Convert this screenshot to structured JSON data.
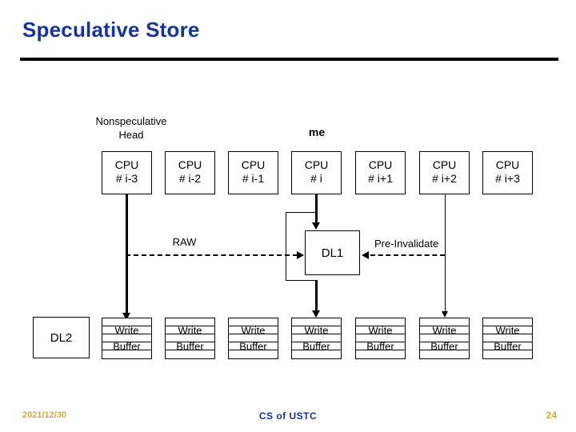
{
  "slide": {
    "title": "Speculative Store",
    "footer": {
      "date": "2021/12/30",
      "center": "CS of USTC",
      "page_number": "24"
    },
    "colors": {
      "title": "#17349a",
      "rule": "#000000",
      "footer_accent": "#d2aa3c",
      "footer_center": "#17349a",
      "diagram_line": "#000000",
      "background": "#ffffff"
    }
  },
  "diagram": {
    "labels": {
      "nonspeculative_head_line1": "Nonspeculative",
      "nonspeculative_head_line2": "Head",
      "me": "me",
      "raw": "RAW",
      "pre_invalidate": "Pre-Invalidate"
    },
    "cpus": [
      {
        "line1": "CPU",
        "line2": "# i-3"
      },
      {
        "line1": "CPU",
        "line2": "# i-2"
      },
      {
        "line1": "CPU",
        "line2": "# i-1"
      },
      {
        "line1": "CPU",
        "line2": "# i"
      },
      {
        "line1": "CPU",
        "line2": "# i+1"
      },
      {
        "line1": "CPU",
        "line2": "# i+2"
      },
      {
        "line1": "CPU",
        "line2": "# i+3"
      }
    ],
    "cache": {
      "dl1": "DL1",
      "dl2": "DL2"
    },
    "write_buffers": [
      {
        "line1": "Write",
        "line2": "Buffer"
      },
      {
        "line1": "Write",
        "line2": "Buffer"
      },
      {
        "line1": "Write",
        "line2": "Buffer"
      },
      {
        "line1": "Write",
        "line2": "Buffer"
      },
      {
        "line1": "Write",
        "line2": "Buffer"
      },
      {
        "line1": "Write",
        "line2": "Buffer"
      },
      {
        "line1": "Write",
        "line2": "Buffer"
      }
    ]
  }
}
